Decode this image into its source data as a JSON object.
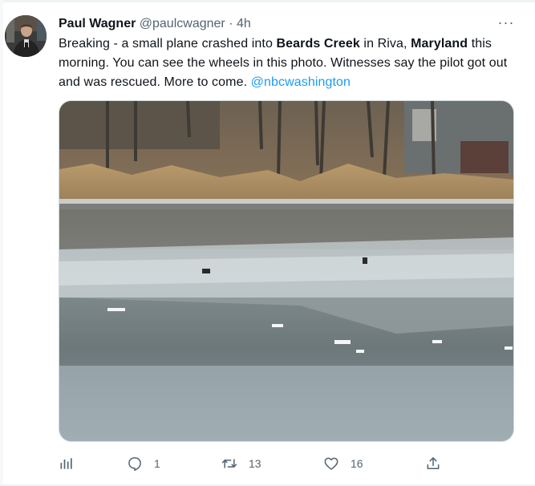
{
  "tweet": {
    "author_name": "Paul Wagner",
    "handle": "@paulcwagner",
    "separator": "·",
    "time": "4h",
    "more_label": "···",
    "text_parts": [
      {
        "text": "Breaking - a small plane crashed into ",
        "style": "normal"
      },
      {
        "text": "Beards Creek",
        "style": "bold"
      },
      {
        "text": " in Riva, ",
        "style": "normal"
      },
      {
        "text": "Maryland",
        "style": "bold"
      },
      {
        "text": " this morning. You can see the wheels in this photo. Witnesses say the pilot got out and was rescued. More to come. ",
        "style": "normal"
      },
      {
        "text": "@nbcwashington",
        "style": "mention"
      }
    ]
  },
  "actions": {
    "views_icon": "analytics-icon",
    "reply_icon": "reply-icon",
    "reply_count": "1",
    "retweet_icon": "retweet-icon",
    "retweet_count": "13",
    "like_icon": "heart-icon",
    "like_count": "16",
    "share_icon": "share-icon"
  },
  "colors": {
    "text": "#0f1419",
    "secondary": "#536471",
    "link": "#1d9bf0"
  }
}
